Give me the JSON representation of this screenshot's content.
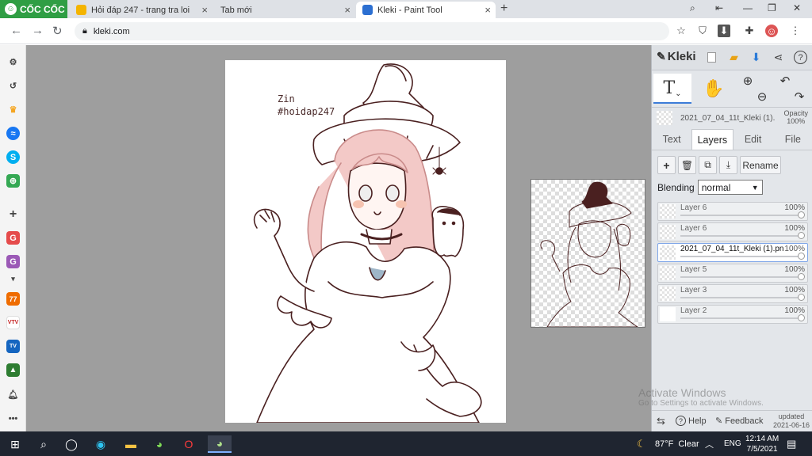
{
  "browser": {
    "brand": "CỐC CỐC",
    "tabs": [
      {
        "title": "Hỏi đáp 247 - trang tra loi"
      },
      {
        "title": "Tab mới"
      },
      {
        "title": "Kleki - Paint Tool"
      }
    ],
    "new_tab": "+",
    "address": "kleki.com"
  },
  "sidebar": {
    "items": [
      "settings-icon",
      "history-icon",
      "crown-icon",
      "messenger-icon",
      "skype-icon",
      "game-icon",
      "add-icon",
      "g-app-icon",
      "g-app-icon-2",
      "expand-icon",
      "news-77-icon",
      "vtv-icon",
      "tv-icon",
      "education-icon",
      "bell-icon",
      "more-icon"
    ]
  },
  "canvas": {
    "text_line1": "Zin",
    "text_line2": "#hoidap247"
  },
  "kleki": {
    "logo": "Kleki",
    "file_name": "2021_07_04_11t_Kleki (1).p",
    "opacity_label": "Opacity",
    "opacity_value": "100%",
    "tabs": [
      "Text",
      "Layers",
      "Edit",
      "File"
    ],
    "active_tab": "Layers",
    "rename_label": "Rename",
    "blending_label": "Blending",
    "blending_value": "normal",
    "layers": [
      {
        "name": "Layer 6",
        "opacity": "100%"
      },
      {
        "name": "Layer 6",
        "opacity": "100%"
      },
      {
        "name": "2021_07_04_11t_Kleki (1).pn",
        "opacity": "100%"
      },
      {
        "name": "Layer 5",
        "opacity": "100%"
      },
      {
        "name": "Layer 3",
        "opacity": "100%"
      },
      {
        "name": "Layer 2",
        "opacity": "100%"
      }
    ],
    "help_label": "Help",
    "feedback_label": "Feedback",
    "updated_label": "updated",
    "updated_date": "2021-06-16"
  },
  "watermark": {
    "line1": "Activate Windows",
    "line2": "Go to Settings to activate Windows."
  },
  "taskbar": {
    "weather_temp": "87°F",
    "weather_text": "Clear",
    "language": "ENG",
    "time": "12:14 AM",
    "date": "7/5/2021"
  }
}
